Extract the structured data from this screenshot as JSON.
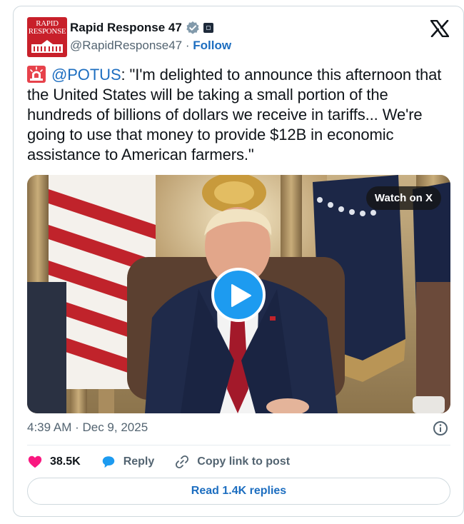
{
  "account": {
    "display_name": "Rapid Response 47",
    "handle": "@RapidResponse47",
    "separator": "·",
    "follow_label": "Follow",
    "avatar_text_line1": "RAPID",
    "avatar_text_line2": "RESPONSE",
    "verified_icon": "verified-badge-icon",
    "affiliate_icon": "org-affiliate-badge-icon"
  },
  "tweet": {
    "mention": "@POTUS",
    "text": ": \"I'm delighted to announce this afternoon that the United States will be taking a small portion of the hundreds of billions of dollars we receive in tariffs... We're going to use that money to provide $12B in economic assistance to American farmers.\"",
    "leading_icon": "siren-icon",
    "timestamp": "4:39 AM · Dec 9, 2025"
  },
  "media": {
    "watch_label": "Watch on X",
    "play_icon": "play-icon"
  },
  "actions": {
    "likes": "38.5K",
    "reply_label": "Reply",
    "copy_label": "Copy link to post",
    "read_replies_label": "Read 1.4K replies"
  },
  "colors": {
    "link": "#1d6ec0",
    "like": "#f91880",
    "reply": "#1d9bf0",
    "play": "#1d9bf0",
    "avatar_bg": "#c8202a"
  }
}
